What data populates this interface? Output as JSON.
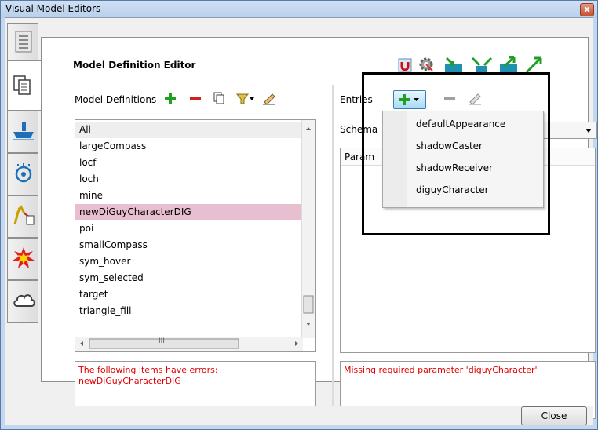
{
  "window": {
    "title": "Visual Model Editors",
    "close_glyph": "x"
  },
  "editor": {
    "title": "Model Definition Editor"
  },
  "left": {
    "label": "Model Definitions",
    "list": {
      "header": "All",
      "items": [
        "largeCompass",
        "locf",
        "loch",
        "mine",
        "newDiGuyCharacterDIG",
        "poi",
        "smallCompass",
        "sym_hover",
        "sym_selected",
        "target",
        "triangle_fill"
      ],
      "selected_index": 4
    },
    "scrollbar": {
      "thumb_label": "III"
    },
    "error_line1": "The following items have errors:",
    "error_line2": "newDiGuyCharacterDIG"
  },
  "right": {
    "entries_label": "Entries",
    "schema_label": "Schema",
    "param_header": "Param",
    "error": "Missing required parameter 'diguyCharacter'"
  },
  "dropdown": {
    "items": [
      "defaultAppearance",
      "shadowCaster",
      "shadowReceiver",
      "diguyCharacter"
    ]
  },
  "footer": {
    "close_label": "Close"
  },
  "colors": {
    "selection": "#e8bfd1",
    "error_text": "#e00000",
    "window_frame": "#c4d7ef"
  }
}
